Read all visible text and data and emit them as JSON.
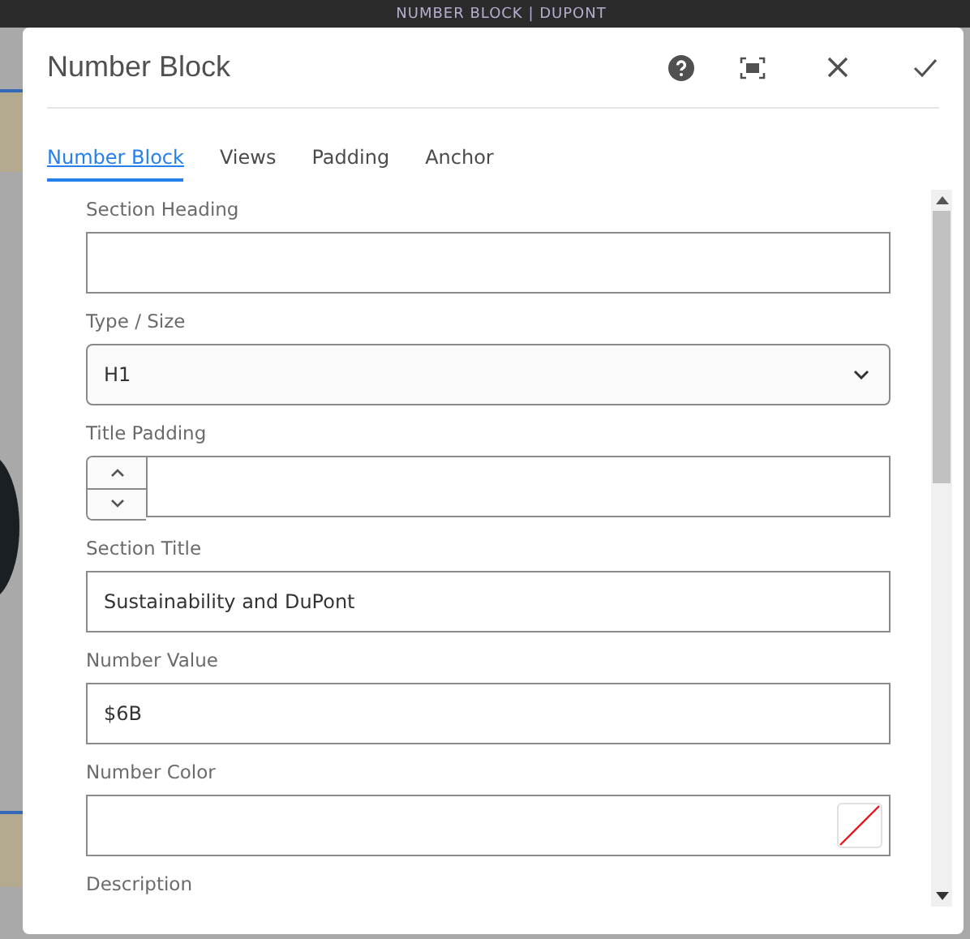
{
  "top_bar": {
    "title": "NUMBER BLOCK | DUPONT"
  },
  "dialog": {
    "title": "Number Block"
  },
  "tabs": [
    {
      "label": "Number Block",
      "selected": true
    },
    {
      "label": "Views",
      "selected": false
    },
    {
      "label": "Padding",
      "selected": false
    },
    {
      "label": "Anchor",
      "selected": false
    }
  ],
  "fields": [
    {
      "kind": "text",
      "label": "Section Heading"
    },
    {
      "kind": "select",
      "label": "Type / Size",
      "value": "H1"
    },
    {
      "kind": "number",
      "label": "Title Padding"
    },
    {
      "kind": "text",
      "label": "Section Title",
      "value": "Sustainability and DuPont"
    },
    {
      "kind": "text",
      "label": "Number Value",
      "value": "$6B"
    },
    {
      "kind": "color",
      "label": "Number Color"
    },
    {
      "kind": "label",
      "label": "Description"
    }
  ]
}
